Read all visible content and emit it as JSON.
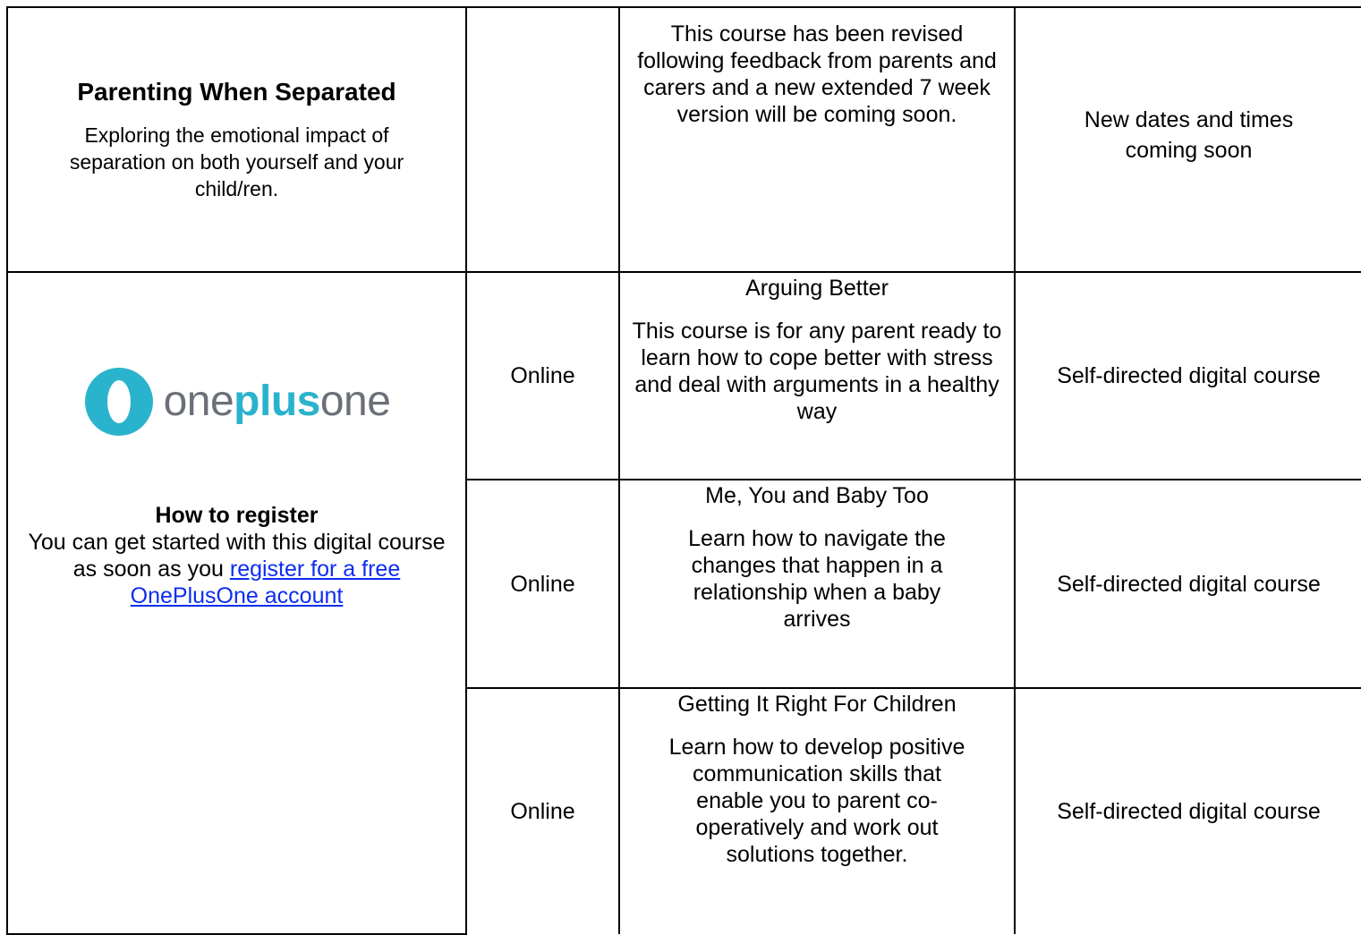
{
  "parenting_when_separated": {
    "title": "Parenting When Separated",
    "description": "Exploring the emotional impact of separation on both yourself and your child/ren.",
    "location": "",
    "info": "This course has been revised following feedback from parents and carers and a new extended 7 week version will be coming soon.",
    "status": "New dates and times coming soon"
  },
  "oneplusone": {
    "logo": {
      "prefix": "one",
      "highlight": "plus",
      "suffix": "one",
      "icon": "oneplusone-logo-icon",
      "colors": {
        "brand_teal": "#2ab3cc",
        "text_grey": "#6b6f78"
      }
    },
    "register_heading": "How to register",
    "register_text": "You can get started with this digital course as soon as you ",
    "register_link": "register for a free OnePlusOne account",
    "link_color": "#0b2df0"
  },
  "courses": [
    {
      "location": "Online",
      "title": "Arguing Better",
      "description": "This course is for any parent ready to learn how to cope better with stress and deal with arguments in a healthy way",
      "format": "Self-directed digital course"
    },
    {
      "location": "Online",
      "title": "Me, You and Baby Too",
      "description": "Learn how to navigate the changes that happen in a relationship when a baby arrives",
      "format": "Self-directed digital course"
    },
    {
      "location": "Online",
      "title": "Getting It Right For Children",
      "description": "Learn how to develop positive communication skills that enable you to parent co-operatively and work out solutions together.",
      "format": "Self-directed digital course"
    }
  ]
}
